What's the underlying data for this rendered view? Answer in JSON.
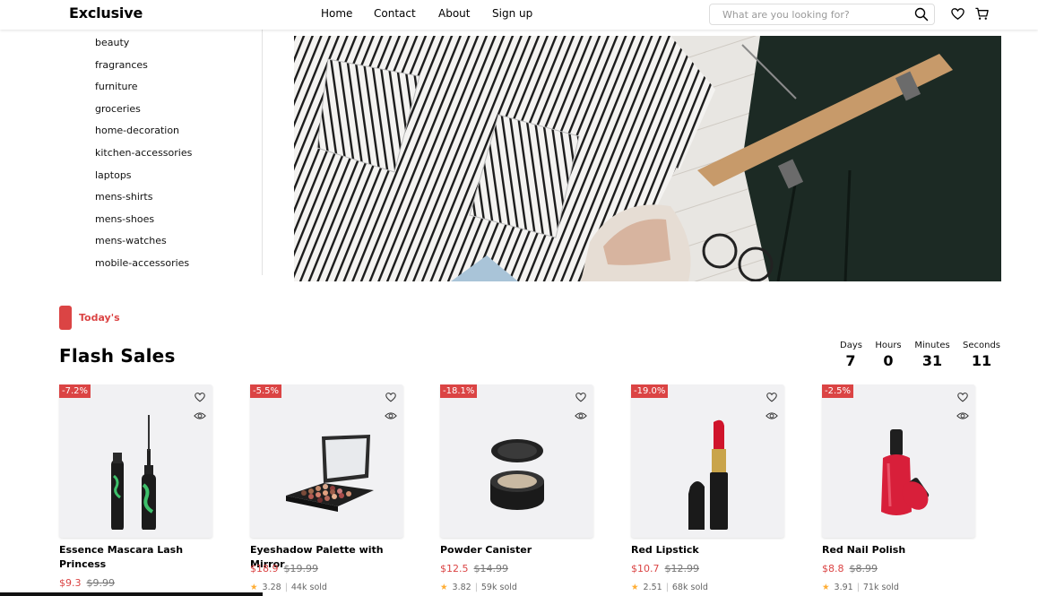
{
  "header": {
    "logo": "Exclusive",
    "nav": [
      "Home",
      "Contact",
      "About",
      "Sign up"
    ],
    "search_placeholder": "What are you looking for?",
    "icons": [
      "search-icon",
      "heart-icon",
      "cart-icon"
    ]
  },
  "categories": [
    "beauty",
    "fragrances",
    "furniture",
    "groceries",
    "home-decoration",
    "kitchen-accessories",
    "laptops",
    "mens-shirts",
    "mens-shoes",
    "mens-watches",
    "mobile-accessories"
  ],
  "section": {
    "label": "Today's",
    "title": "Flash Sales",
    "accent": "#DB4444"
  },
  "countdown": {
    "days_label": "Days",
    "days": "7",
    "hours_label": "Hours",
    "hours": "0",
    "minutes_label": "Minutes",
    "minutes": "31",
    "seconds_label": "Seconds",
    "seconds": "11"
  },
  "products": [
    {
      "discount": "-7.2%",
      "name": "Essence Mascara Lash Princess",
      "price": "$9.3",
      "old_price": "$9.99",
      "rating": "",
      "sold": ""
    },
    {
      "discount": "-5.5%",
      "name": "Eyeshadow Palette with Mirror",
      "price": "$18.9",
      "old_price": "$19.99",
      "rating": "3.28",
      "sold": "44k sold"
    },
    {
      "discount": "-18.1%",
      "name": "Powder Canister",
      "price": "$12.5",
      "old_price": "$14.99",
      "rating": "3.82",
      "sold": "59k sold"
    },
    {
      "discount": "-19.0%",
      "name": "Red Lipstick",
      "price": "$10.7",
      "old_price": "$12.99",
      "rating": "2.51",
      "sold": "68k sold"
    },
    {
      "discount": "-2.5%",
      "name": "Red Nail Polish",
      "price": "$8.8",
      "old_price": "$8.99",
      "rating": "3.91",
      "sold": "71k sold"
    }
  ]
}
